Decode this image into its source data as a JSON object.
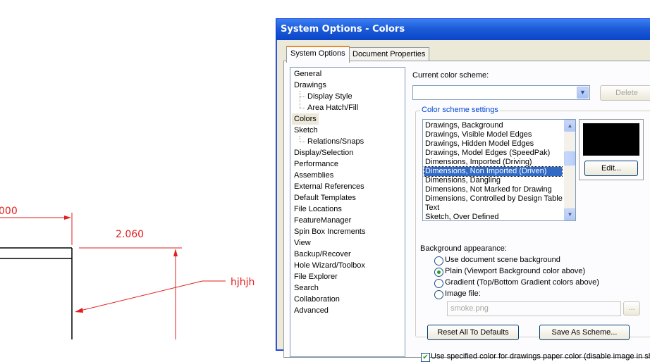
{
  "cad": {
    "dim_left": "000",
    "dim_value": "2.060",
    "note": "hjhjh"
  },
  "dialog": {
    "title": "System Options - Colors",
    "tabs": [
      "System Options",
      "Document Properties"
    ],
    "tree": [
      {
        "label": "General",
        "level": 0
      },
      {
        "label": "Drawings",
        "level": 0
      },
      {
        "label": "Display Style",
        "level": 1
      },
      {
        "label": "Area Hatch/Fill",
        "level": 1
      },
      {
        "label": "Colors",
        "level": 0,
        "selected": true
      },
      {
        "label": "Sketch",
        "level": 0
      },
      {
        "label": "Relations/Snaps",
        "level": 1
      },
      {
        "label": "Display/Selection",
        "level": 0
      },
      {
        "label": "Performance",
        "level": 0
      },
      {
        "label": "Assemblies",
        "level": 0
      },
      {
        "label": "External References",
        "level": 0
      },
      {
        "label": "Default Templates",
        "level": 0
      },
      {
        "label": "File Locations",
        "level": 0
      },
      {
        "label": "FeatureManager",
        "level": 0
      },
      {
        "label": "Spin Box Increments",
        "level": 0
      },
      {
        "label": "View",
        "level": 0
      },
      {
        "label": "Backup/Recover",
        "level": 0
      },
      {
        "label": "Hole Wizard/Toolbox",
        "level": 0
      },
      {
        "label": "File Explorer",
        "level": 0
      },
      {
        "label": "Search",
        "level": 0
      },
      {
        "label": "Collaboration",
        "level": 0
      },
      {
        "label": "Advanced",
        "level": 0
      }
    ],
    "current_scheme_label": "Current color scheme:",
    "current_scheme_value": "",
    "delete_label": "Delete",
    "group_title": "Color scheme settings",
    "color_items": [
      "Drawings, Background",
      "Drawings, Visible Model Edges",
      "Drawings, Hidden Model Edges",
      "Drawings, Model Edges (SpeedPak)",
      "Dimensions, Imported (Driving)",
      "Dimensions, Non Imported (Driven)",
      "Dimensions, Dangling",
      "Dimensions, Not Marked for Drawing",
      "Dimensions, Controlled by Design Table",
      "Text",
      "Sketch, Over Defined"
    ],
    "selected_color_index": 5,
    "swatch_color": "#000000",
    "edit_label": "Edit...",
    "bg_appearance_label": "Background appearance:",
    "radios": [
      {
        "label": "Use document scene background",
        "checked": false
      },
      {
        "label": "Plain (Viewport Background color above)",
        "checked": true
      },
      {
        "label": "Gradient (Top/Bottom Gradient colors above)",
        "checked": false
      },
      {
        "label": "Image file:",
        "checked": false
      }
    ],
    "image_file_value": "smoke.png",
    "browse_label": "...",
    "reset_label": "Reset All To Defaults",
    "save_scheme_label": "Save As Scheme...",
    "checkbox_label": "Use specified color for drawings paper color (disable image in sheet"
  }
}
